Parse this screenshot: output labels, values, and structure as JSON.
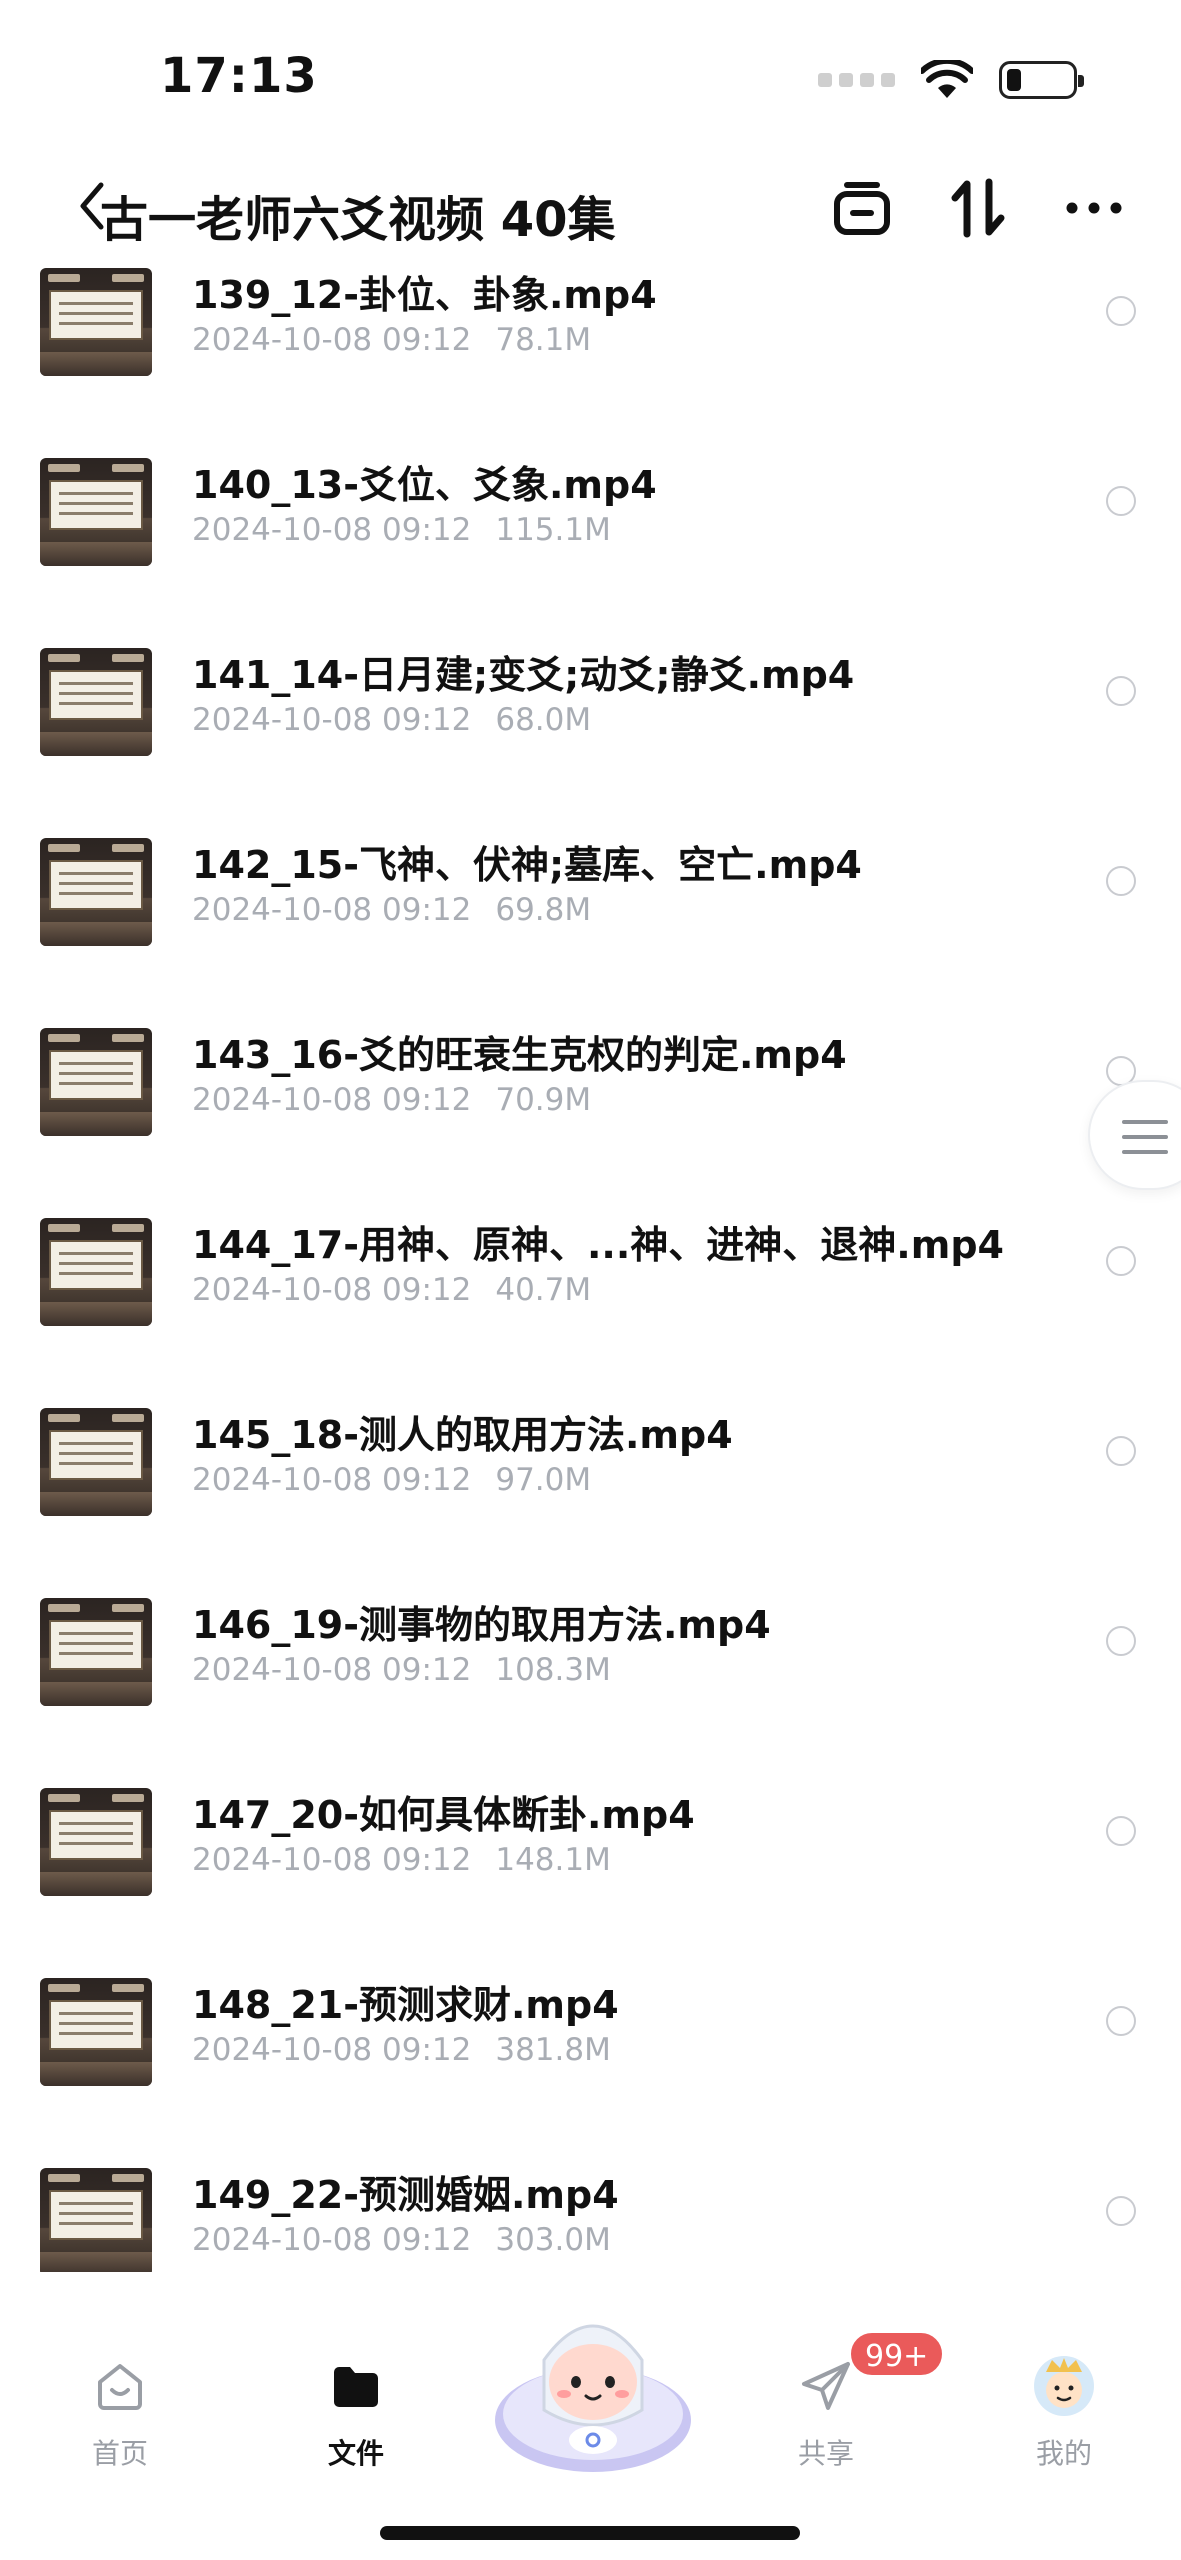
{
  "status_bar": {
    "time": "17:13"
  },
  "header": {
    "title": "古一老师六爻视频 40集"
  },
  "files": [
    {
      "name": "139_12-卦位、卦象.mp4",
      "date": "2024-10-08 09:12",
      "size": "78.1M"
    },
    {
      "name": "140_13-爻位、爻象.mp4",
      "date": "2024-10-08 09:12",
      "size": "115.1M"
    },
    {
      "name": "141_14-日月建;变爻;动爻;静爻.mp4",
      "date": "2024-10-08 09:12",
      "size": "68.0M"
    },
    {
      "name": "142_15-飞神、伏神;墓库、空亡.mp4",
      "date": "2024-10-08 09:12",
      "size": "69.8M"
    },
    {
      "name": "143_16-爻的旺衰生克权的判定.mp4",
      "date": "2024-10-08 09:12",
      "size": "70.9M"
    },
    {
      "name": "144_17-用神、原神、...神、进神、退神.mp4",
      "date": "2024-10-08 09:12",
      "size": "40.7M"
    },
    {
      "name": "145_18-测人的取用方法.mp4",
      "date": "2024-10-08 09:12",
      "size": "97.0M"
    },
    {
      "name": "146_19-测事物的取用方法.mp4",
      "date": "2024-10-08 09:12",
      "size": "108.3M"
    },
    {
      "name": "147_20-如何具体断卦.mp4",
      "date": "2024-10-08 09:12",
      "size": "148.1M"
    },
    {
      "name": "148_21-预测求财.mp4",
      "date": "2024-10-08 09:12",
      "size": "381.8M"
    },
    {
      "name": "149_22-预测婚姻.mp4",
      "date": "2024-10-08 09:12",
      "size": "303.0M"
    }
  ],
  "tabs": [
    {
      "label": "首页",
      "icon": "home-icon"
    },
    {
      "label": "文件",
      "icon": "folder-icon"
    },
    {
      "label": "",
      "icon": "assistant-mascot"
    },
    {
      "label": "共享",
      "icon": "share-plane-icon",
      "badge": "99+"
    },
    {
      "label": "我的",
      "icon": "profile-avatar"
    }
  ]
}
